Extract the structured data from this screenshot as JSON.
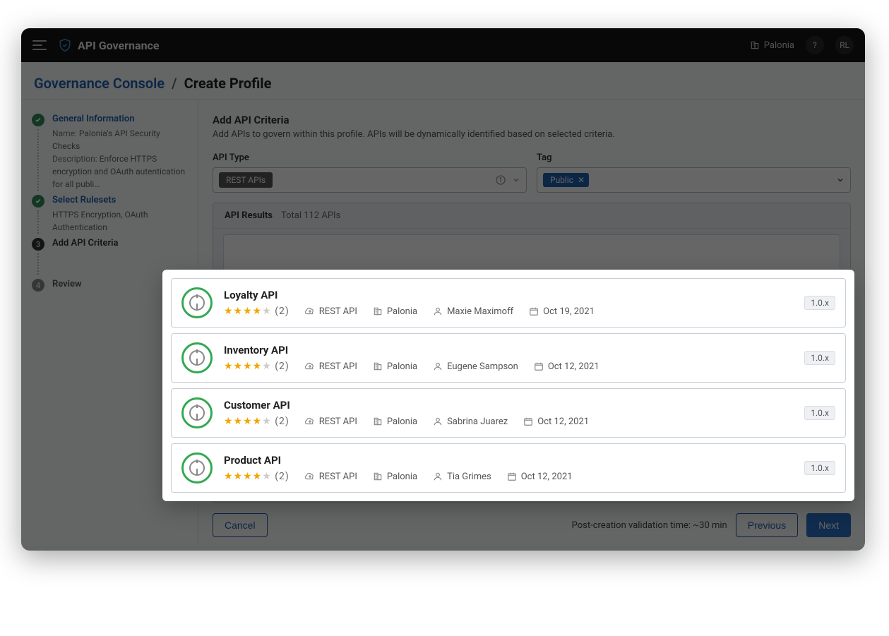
{
  "topbar": {
    "app_title": "API Governance",
    "org_name": "Palonia",
    "help_label": "?",
    "user_initials": "RL"
  },
  "breadcrumb": {
    "parent": "Governance Console",
    "separator": "/",
    "current": "Create Profile"
  },
  "sidebar": {
    "steps": [
      {
        "label": "General Information",
        "name_label": "Name:",
        "name_value": "Palonia's API Security Checks",
        "desc_label": "Description:",
        "desc_value": "Enforce HTTPS encryption and OAuth autentication for all publi…"
      },
      {
        "label": "Select Rulesets",
        "detail": "HTTPS Encryption, OAuth Authentication"
      },
      {
        "label": "Add API Criteria",
        "number": "3"
      },
      {
        "label": "Review",
        "number": "4"
      }
    ]
  },
  "main": {
    "heading": "Add API Criteria",
    "sub": "Add APIs to govern within this profile. APIs will be dynamically identified based on selected criteria.",
    "api_type_label": "API Type",
    "api_type_value": "REST APIs",
    "tag_label": "Tag",
    "tag_value": "Public",
    "results_title": "API Results",
    "results_count": "Total 112 APIs"
  },
  "footer": {
    "cancel": "Cancel",
    "validation_text": "Post-creation validation time: ~30 min",
    "previous": "Previous",
    "next": "Next"
  },
  "popup": {
    "apis": [
      {
        "name": "Loyalty API",
        "rating_count": "(2)",
        "type": "REST API",
        "org": "Palonia",
        "owner": "Maxie Maximoff",
        "date": "Oct 19, 2021",
        "version": "1.0.x"
      },
      {
        "name": "Inventory API",
        "rating_count": "(2)",
        "type": "REST API",
        "org": "Palonia",
        "owner": "Eugene Sampson",
        "date": "Oct 12, 2021",
        "version": "1.0.x"
      },
      {
        "name": "Customer API",
        "rating_count": "(2)",
        "type": "REST API",
        "org": "Palonia",
        "owner": "Sabrina Juarez",
        "date": "Oct 12, 2021",
        "version": "1.0.x"
      },
      {
        "name": "Product API",
        "rating_count": "(2)",
        "type": "REST API",
        "org": "Palonia",
        "owner": "Tia Grimes",
        "date": "Oct 12, 2021",
        "version": "1.0.x"
      }
    ]
  }
}
